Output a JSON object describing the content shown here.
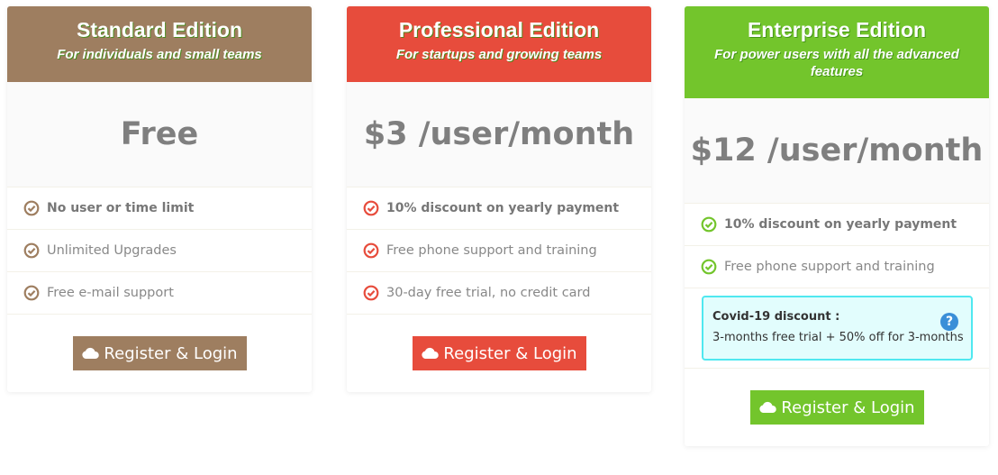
{
  "plans": [
    {
      "title": "Standard Edition",
      "subtitle": "For individuals and small teams",
      "price": "Free",
      "accent": "#9e7e60",
      "features": [
        "No user or time limit",
        "Unlimited Upgrades",
        "Free e-mail support"
      ],
      "button": "Register & Login"
    },
    {
      "title": "Professional Edition",
      "subtitle": "For startups and growing teams",
      "price": "$3 /user/month",
      "accent": "#e74c3c",
      "features": [
        "10% discount on yearly payment",
        "Free phone support and training",
        "30-day free trial, no credit card"
      ],
      "button": "Register & Login"
    },
    {
      "title": "Enterprise Edition",
      "subtitle": "For power users with all the advanced features",
      "price": "$12 /user/month",
      "accent": "#73c52c",
      "features": [
        "10% discount on yearly payment",
        "Free phone support and training"
      ],
      "promo": {
        "title": "Covid-19 discount :",
        "body": "3-months free trial + 50% off for 3-months",
        "icon": "question-circle-icon"
      },
      "button": "Register & Login"
    }
  ],
  "icons": {
    "feature": "check-circle-icon",
    "button": "cloud-icon"
  }
}
